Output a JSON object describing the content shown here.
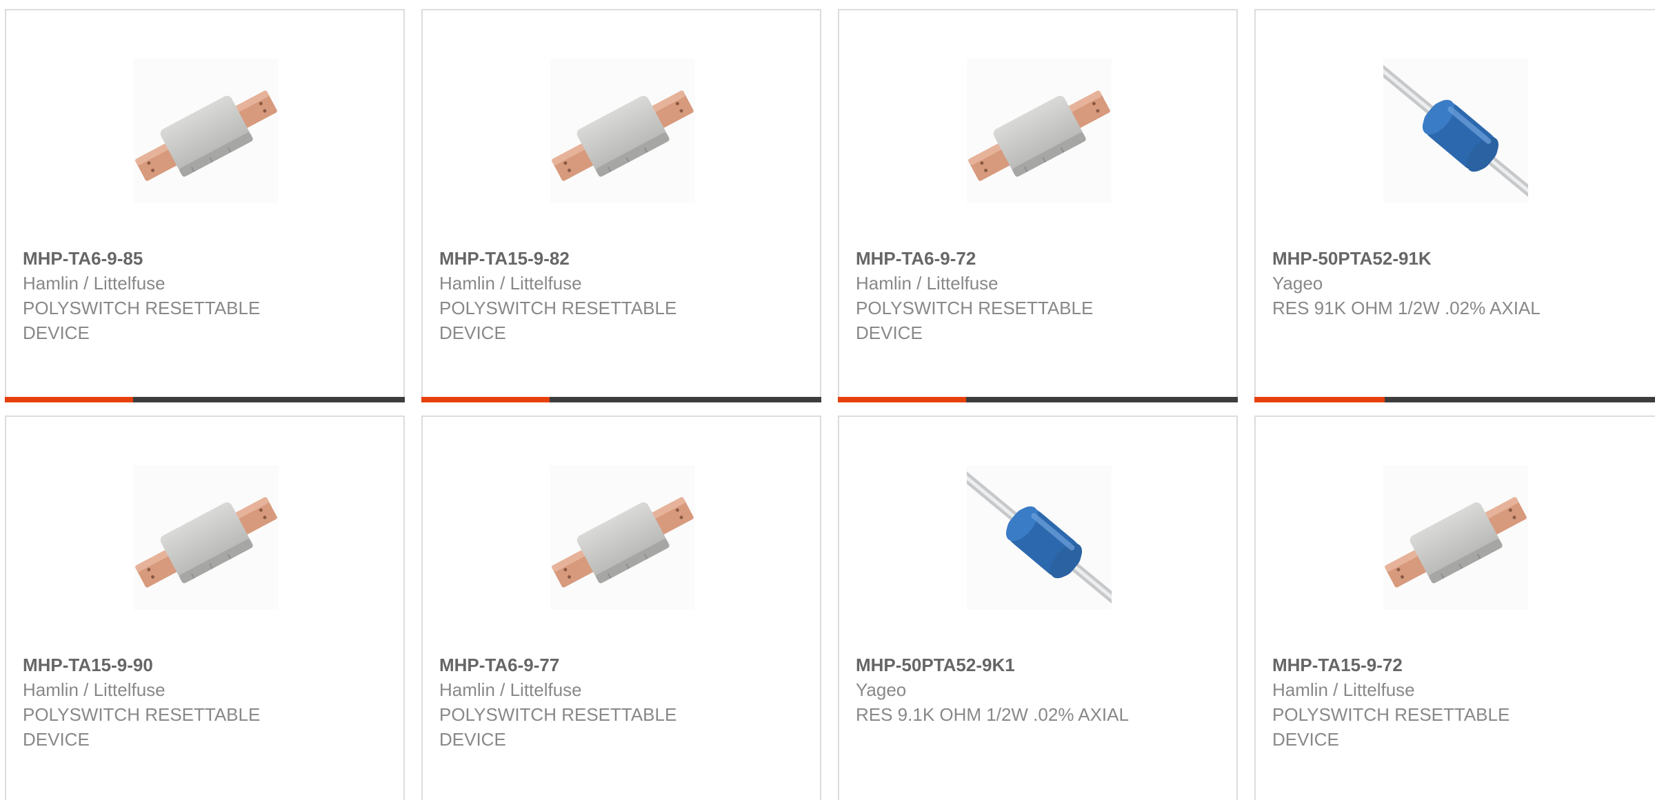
{
  "colors": {
    "card_border": "#dcdcdc",
    "bar_dark": "#3d3d3d",
    "bar_accent": "#e8400c",
    "part_text": "#666666",
    "body_text": "#888888",
    "fuse_body": "#c8c9c6",
    "fuse_tab": "#d79a7d",
    "resistor_body": "#2f6fb8",
    "resistor_lead": "#d5d7d9"
  },
  "products": [
    {
      "part": "MHP-TA6-9-85",
      "manufacturer": "Hamlin / Littelfuse",
      "description": "POLYSWITCH RESETTABLE DEVICE",
      "image_icon": "resettable-fuse-icon",
      "accent_fill": 0.32
    },
    {
      "part": "MHP-TA15-9-82",
      "manufacturer": "Hamlin / Littelfuse",
      "description": "POLYSWITCH RESETTABLE DEVICE",
      "image_icon": "resettable-fuse-icon",
      "accent_fill": 0.32
    },
    {
      "part": "MHP-TA6-9-72",
      "manufacturer": "Hamlin / Littelfuse",
      "description": "POLYSWITCH RESETTABLE DEVICE",
      "image_icon": "resettable-fuse-icon",
      "accent_fill": 0.32
    },
    {
      "part": "MHP-50PTA52-91K",
      "manufacturer": "Yageo",
      "description": "RES 91K OHM 1/2W .02% AXIAL",
      "image_icon": "axial-resistor-icon",
      "accent_fill": 0.32
    },
    {
      "part": "MHP-TA15-9-90",
      "manufacturer": "Hamlin / Littelfuse",
      "description": "POLYSWITCH RESETTABLE DEVICE",
      "image_icon": "resettable-fuse-icon"
    },
    {
      "part": "MHP-TA6-9-77",
      "manufacturer": "Hamlin / Littelfuse",
      "description": "POLYSWITCH RESETTABLE DEVICE",
      "image_icon": "resettable-fuse-icon"
    },
    {
      "part": "MHP-50PTA52-9K1",
      "manufacturer": "Yageo",
      "description": "RES 9.1K OHM 1/2W .02% AXIAL",
      "image_icon": "axial-resistor-icon"
    },
    {
      "part": "MHP-TA15-9-72",
      "manufacturer": "Hamlin / Littelfuse",
      "description": "POLYSWITCH RESETTABLE DEVICE",
      "image_icon": "resettable-fuse-icon"
    }
  ]
}
